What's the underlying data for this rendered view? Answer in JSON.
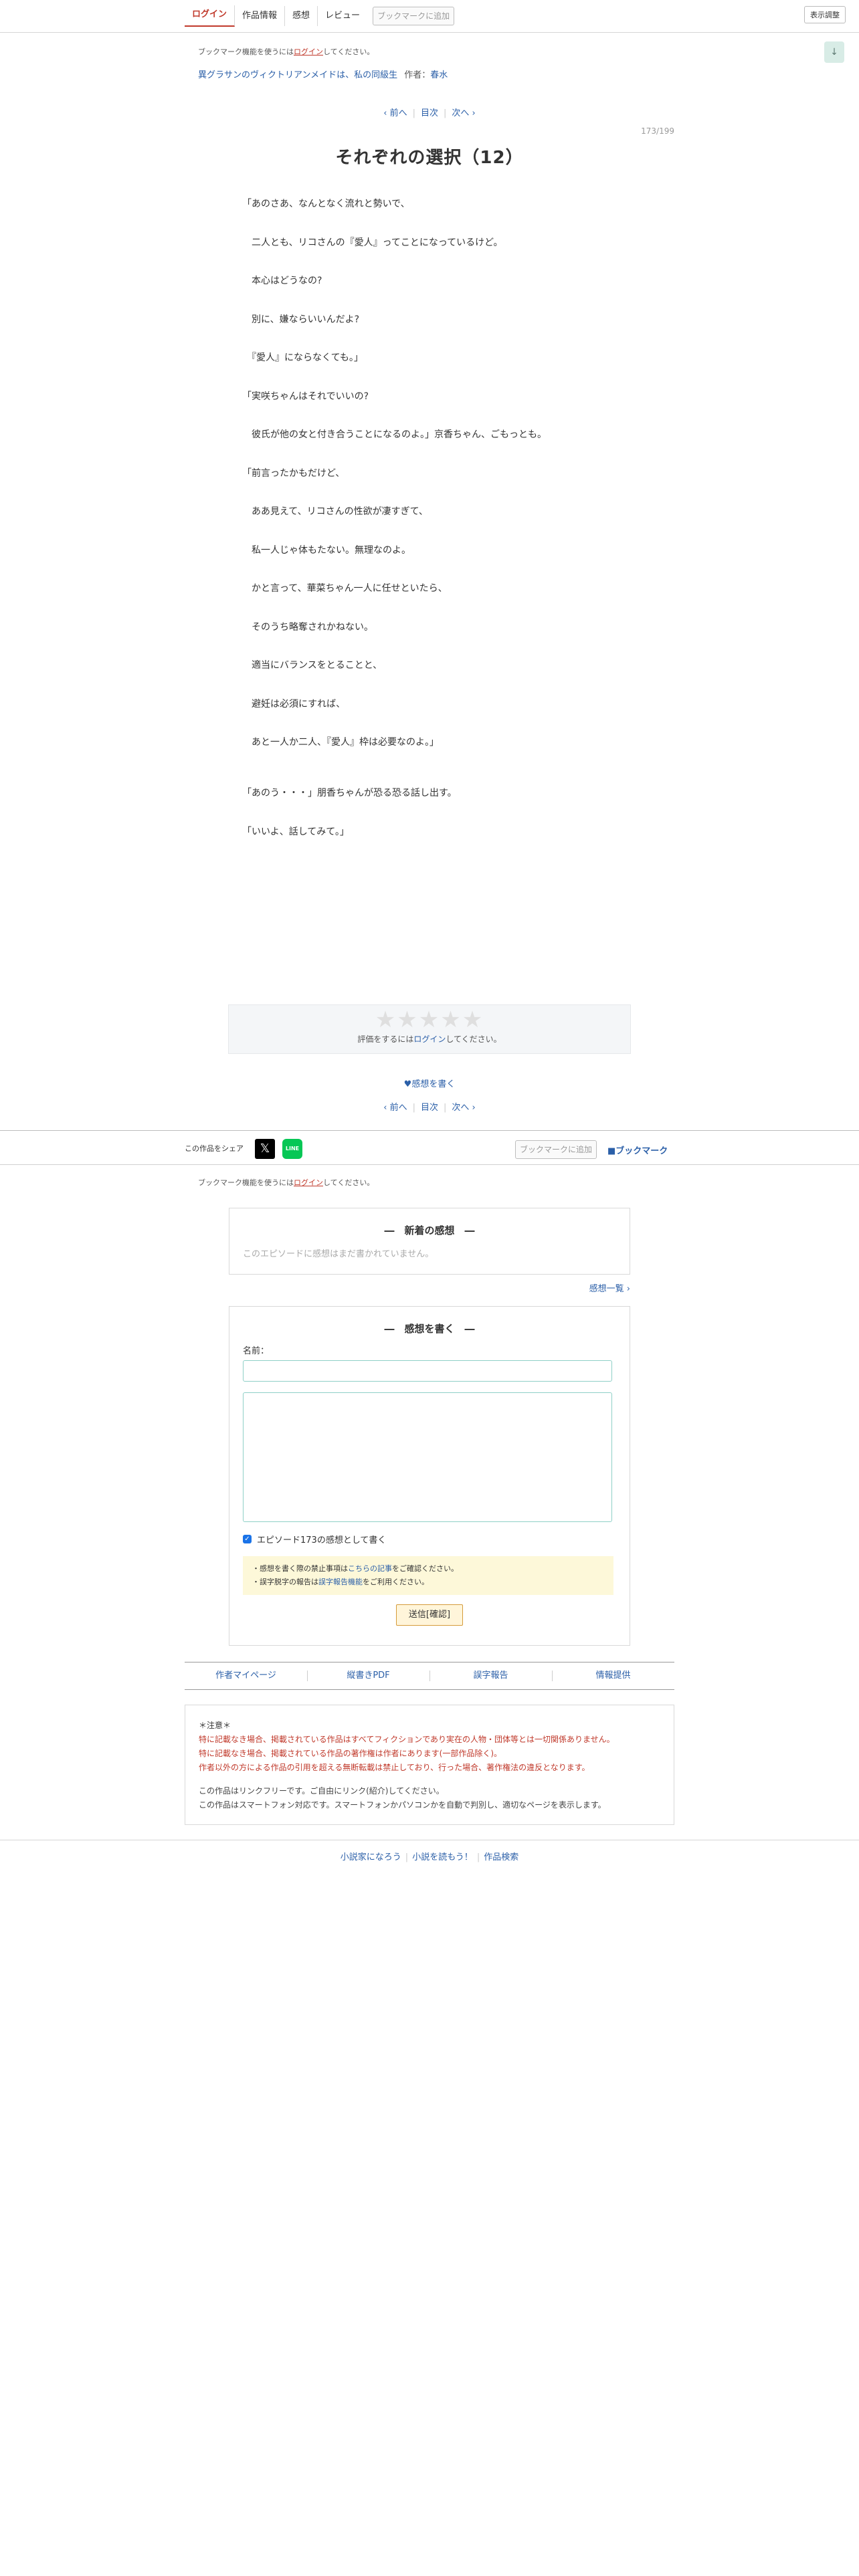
{
  "nav": {
    "items": [
      "ログイン",
      "作品情報",
      "感想",
      "レビュー"
    ],
    "bookmark_add": "ブックマークに追加",
    "display_settings": "表示調整",
    "down_arrow": "↓"
  },
  "notice": {
    "prefix": "ブックマーク機能を使うには",
    "link": "ログイン",
    "suffix": "してください。"
  },
  "novel": {
    "title": "異グラサンのヴィクトリアンメイドは、私の同級生",
    "author_label": "作者：",
    "author": "春水"
  },
  "pager": {
    "prev": "‹ 前へ",
    "toc": "目次",
    "next": "次へ ›"
  },
  "counter": "173/199",
  "chapter_title": "それぞれの選択（12）",
  "body": [
    "「あのさあ、なんとなく流れと勢いで、",
    "　二人とも、リコさんの『愛人』ってことになっているけど。",
    "　本心はどうなの?",
    "　別に、嫌ならいいんだよ?",
    "　『愛人』にならなくても。」",
    "「実咲ちゃんはそれでいいの?",
    "　彼氏が他の女と付き合うことになるのよ。」京香ちゃん、ごもっとも。",
    "「前言ったかもだけど、",
    "　ああ見えて、リコさんの性欲が凄すぎて、",
    "　私一人じゃ体もたない。無理なのよ。",
    "　かと言って、華菜ちゃん一人に任せといたら、",
    "　そのうち略奪されかねない。",
    "　適当にバランスをとることと、",
    "　避妊は必須にすれば、",
    "　あと一人か二人、『愛人』枠は必要なのよ。」",
    "「あのう・・・」朋香ちゃんが恐る恐る話し出す。",
    "「いいよ、話してみて。」"
  ],
  "rating": {
    "stars": "★★★★★",
    "note_prefix": "評価をするには",
    "note_link": "ログイン",
    "note_suffix": "してください。"
  },
  "impression_link": "♥感想を書く",
  "share": {
    "label": "この作品をシェア",
    "x_icon": "𝕏",
    "line_icon": "LINE",
    "bookmark_add": "ブックマークに追加",
    "bookmark": "■ブックマーク"
  },
  "latest": {
    "title": "―　新着の感想　―",
    "empty": "このエピソードに感想はまだ書かれていません。",
    "list_link": "感想一覧 ›"
  },
  "write": {
    "title": "―　感想を書く　―",
    "name_label": "名前：",
    "checkbox_label": "エピソード173の感想として書く",
    "caution1_a": "・感想を書く際の禁止事項は",
    "caution1_link": "こちらの記事",
    "caution1_b": "をご確認ください。",
    "caution2_a": "・誤字脱字の報告は",
    "caution2_link": "誤字報告機能",
    "caution2_b": "をご利用ください。",
    "submit": "送信[確認]"
  },
  "footer_links": [
    "作者マイページ",
    "縦書きPDF",
    "誤字報告",
    "情報提供"
  ],
  "info": {
    "head": "＊注意＊",
    "red1": "特に記載なき場合、掲載されている作品はすべてフィクションであり実在の人物・団体等とは一切関係ありません。",
    "red2": "特に記載なき場合、掲載されている作品の著作権は作者にあります(一部作品除く)。",
    "red3": "作者以外の方による作品の引用を超える無断転載は禁止しており、行った場合、著作権法の違反となります。",
    "gray1": "この作品はリンクフリーです。ご自由にリンク(紹介)してください。",
    "gray2": "この作品はスマートフォン対応です。スマートフォンかパソコンかを自動で判別し、適切なページを表示します。"
  },
  "site_footer": [
    "小説家になろう",
    "小説を読もう！",
    "作品検索"
  ]
}
